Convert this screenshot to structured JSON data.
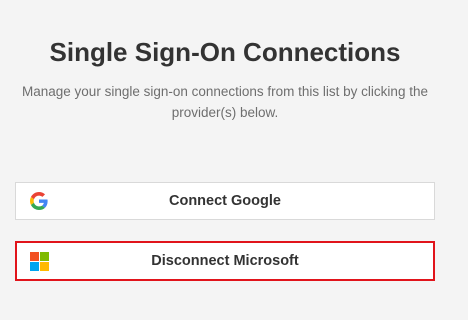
{
  "header": {
    "title": "Single Sign-On Connections",
    "description": "Manage your single sign-on connections from this list by clicking the provider(s) below."
  },
  "providers": [
    {
      "label": "Connect Google",
      "icon": "google-icon",
      "colors": {
        "blue": "#4285F4",
        "red": "#EA4335",
        "yellow": "#FBBC05",
        "green": "#34A853"
      }
    },
    {
      "label": "Disconnect Microsoft",
      "icon": "microsoft-icon",
      "highlighted": true,
      "highlight_color": "#e1141b",
      "colors": {
        "red": "#F25022",
        "green": "#7FBA00",
        "blue": "#00A4EF",
        "yellow": "#FFB900"
      }
    }
  ]
}
